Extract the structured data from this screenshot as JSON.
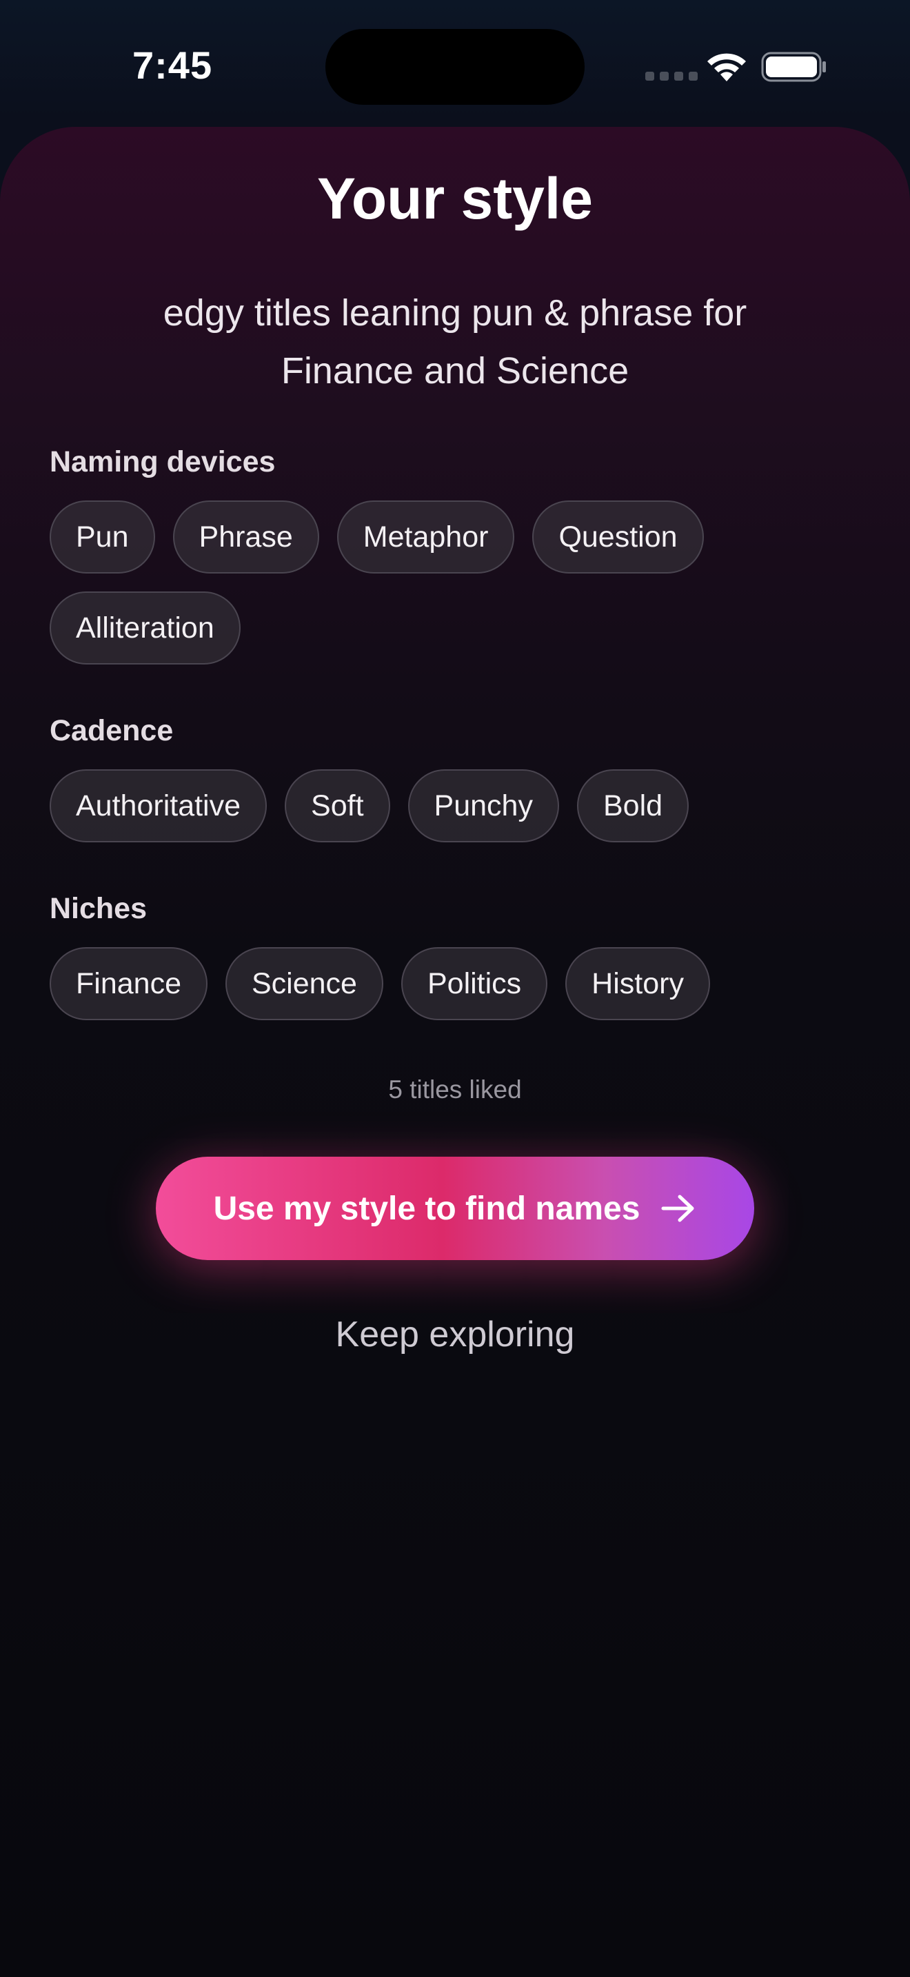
{
  "status_bar": {
    "time": "7:45"
  },
  "header": {
    "title": "Your style",
    "subtitle": "edgy titles leaning pun & phrase for Finance and Science"
  },
  "sections": {
    "naming_devices": {
      "label": "Naming devices",
      "chips": [
        "Pun",
        "Phrase",
        "Metaphor",
        "Question",
        "Alliteration"
      ]
    },
    "cadence": {
      "label": "Cadence",
      "chips": [
        "Authoritative",
        "Soft",
        "Punchy",
        "Bold"
      ]
    },
    "niches": {
      "label": "Niches",
      "chips": [
        "Finance",
        "Science",
        "Politics",
        "History"
      ]
    }
  },
  "summary": {
    "liked_count": "5 titles liked"
  },
  "actions": {
    "primary_label": "Use my style to find names",
    "primary_icon": "arrow-right-icon",
    "secondary_label": "Keep exploring"
  },
  "colors": {
    "accent_start": "#f24d9a",
    "accent_mid": "#dc2a6a",
    "accent_end": "#a847e6"
  }
}
